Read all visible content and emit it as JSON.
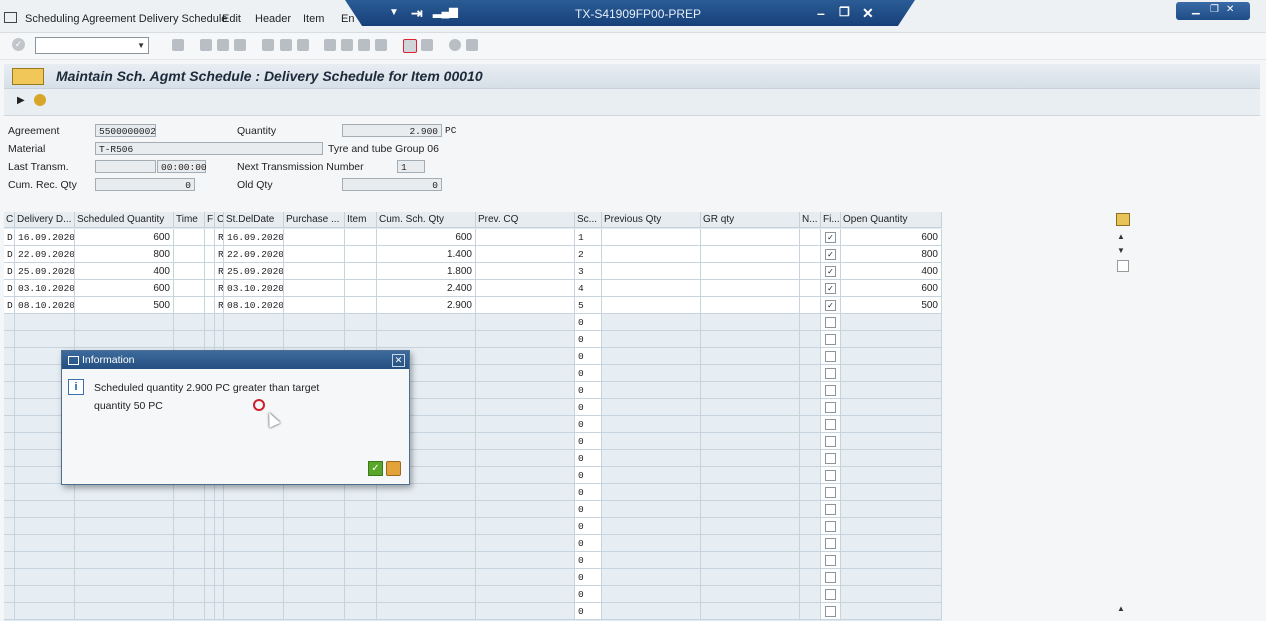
{
  "menubar": {
    "items": [
      "Scheduling Agreement Delivery Schedule",
      "Edit",
      "Header",
      "Item",
      "En"
    ]
  },
  "titlebar": {
    "system": "TX-S41909FP00-PREP"
  },
  "header": {
    "title": "Maintain Sch. Agmt Schedule : Delivery Schedule for Item 00010"
  },
  "form": {
    "agreement_label": "Agreement",
    "agreement_value": "5500000002",
    "quantity_label": "Quantity",
    "quantity_value": "2.900",
    "quantity_unit": "PC",
    "material_label": "Material",
    "material_value": "T-R506",
    "material_desc": "Tyre and tube Group 06",
    "last_transm_label": "Last Transm.",
    "last_transm_date": "",
    "last_transm_time": "00:00:00",
    "next_tx_label": "Next Transmission Number",
    "next_tx_value": "1",
    "cum_rec_label": "Cum. Rec. Qty",
    "cum_rec_value": "0",
    "old_qty_label": "Old Qty",
    "old_qty_value": "0"
  },
  "table": {
    "columns": [
      "C",
      "Delivery D...",
      "Scheduled Quantity",
      "Time",
      "F",
      "C",
      "St.DelDate",
      "Purchase ...",
      "Item",
      "Cum. Sch. Qty",
      "Prev. CQ",
      "Sc...",
      "Previous Qty",
      "GR qty",
      "N...",
      "Fi...",
      "Open Quantity"
    ],
    "rows": [
      {
        "c": "D",
        "date": "16.09.2020",
        "qty": "600",
        "c2": "R",
        "stdate": "16.09.2020",
        "cum": "600",
        "sc": "1",
        "fixed": true,
        "open": "600"
      },
      {
        "c": "D",
        "date": "22.09.2020",
        "qty": "800",
        "c2": "R",
        "stdate": "22.09.2020",
        "cum": "1.400",
        "sc": "2",
        "fixed": true,
        "open": "800"
      },
      {
        "c": "D",
        "date": "25.09.2020",
        "qty": "400",
        "c2": "R",
        "stdate": "25.09.2020",
        "cum": "1.800",
        "sc": "3",
        "fixed": true,
        "open": "400"
      },
      {
        "c": "D",
        "date": "03.10.2020",
        "qty": "600",
        "c2": "R",
        "stdate": "03.10.2020",
        "cum": "2.400",
        "sc": "4",
        "fixed": true,
        "open": "600"
      },
      {
        "c": "D",
        "date": "08.10.2020",
        "qty": "500",
        "c2": "R",
        "stdate": "08.10.2020",
        "cum": "2.900",
        "sc": "5",
        "fixed": true,
        "open": "500"
      }
    ],
    "empty_sc_value": "0",
    "empty_rows": 18
  },
  "dialog": {
    "title": "Information",
    "message_line1": "Scheduled quantity 2.900 PC greater than target",
    "message_line2": "quantity 50 PC"
  },
  "icons": {
    "ok": "checkmark-icon",
    "help": "help-icon",
    "info": "info-icon",
    "close": "close-icon"
  }
}
